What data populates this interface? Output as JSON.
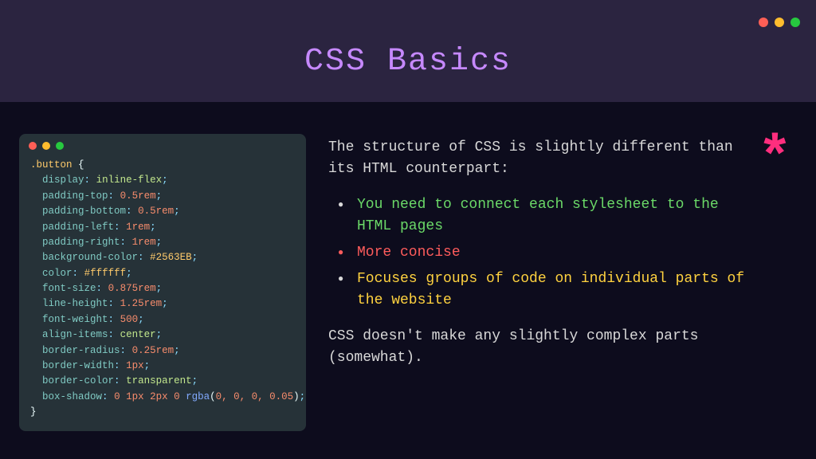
{
  "header": {
    "title": "CSS Basics"
  },
  "code": {
    "selector": ".button",
    "declarations": [
      {
        "prop": "display",
        "value": "inline-flex",
        "kind": "kw"
      },
      {
        "prop": "padding-top",
        "value": "0.5rem",
        "kind": "num"
      },
      {
        "prop": "padding-bottom",
        "value": "0.5rem",
        "kind": "num"
      },
      {
        "prop": "padding-left",
        "value": "1rem",
        "kind": "num"
      },
      {
        "prop": "padding-right",
        "value": "1rem",
        "kind": "num"
      },
      {
        "prop": "background-color",
        "value": "#2563EB",
        "kind": "hex"
      },
      {
        "prop": "color",
        "value": "#ffffff",
        "kind": "hex"
      },
      {
        "prop": "font-size",
        "value": "0.875rem",
        "kind": "num"
      },
      {
        "prop": "line-height",
        "value": "1.25rem",
        "kind": "num"
      },
      {
        "prop": "font-weight",
        "value": "500",
        "kind": "num"
      },
      {
        "prop": "align-items",
        "value": "center",
        "kind": "kw"
      },
      {
        "prop": "border-radius",
        "value": "0.25rem",
        "kind": "num"
      },
      {
        "prop": "border-width",
        "value": "1px",
        "kind": "num"
      },
      {
        "prop": "border-color",
        "value": "transparent",
        "kind": "kw"
      },
      {
        "prop": "box-shadow",
        "value": "0 1px 2px 0 rgba(0, 0, 0, 0.05)",
        "kind": "shadow"
      }
    ]
  },
  "text": {
    "intro": "The structure of CSS is slightly different than its HTML counterpart:",
    "bullets": [
      {
        "text": "You need to connect each stylesheet to the HTML pages",
        "color": "green"
      },
      {
        "text": "More concise",
        "color": "red"
      },
      {
        "text": "Focuses groups of code on individual parts of the website",
        "color": "yellow"
      }
    ],
    "footnote": "CSS doesn't make any slightly complex parts (somewhat).",
    "asterisk": "*"
  }
}
